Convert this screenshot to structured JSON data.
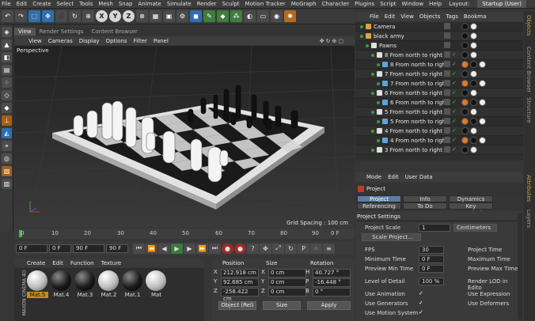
{
  "menubar": {
    "items": [
      "File",
      "Edit",
      "Create",
      "Select",
      "Tools",
      "Mesh",
      "Snap",
      "Animate",
      "Simulate",
      "Render",
      "Sculpt",
      "Motion Tracker",
      "MoGraph",
      "Character",
      "Plugins",
      "Script",
      "Window",
      "Help"
    ],
    "layout_label": "Layout:",
    "layout_value": "Startup (User)"
  },
  "toolbar": {
    "axis_buttons": [
      "X",
      "Y",
      "Z"
    ]
  },
  "viewport": {
    "tabs": [
      "View",
      "Render Settings",
      "Content Browser"
    ],
    "menu": [
      "View",
      "Cameras",
      "Display",
      "Options",
      "Filter",
      "Panel"
    ],
    "camera_label": "Perspective",
    "grid_spacing": "Grid Spacing : 100 cm"
  },
  "timeline": {
    "ticks": [
      "0",
      "10",
      "20",
      "30",
      "40",
      "50",
      "60",
      "70",
      "80",
      "90"
    ],
    "end_label": "0 F"
  },
  "transport": {
    "start_frame": "0 F",
    "current_frame": "0 F",
    "end_frame": "90 F",
    "max_frame": "90 F"
  },
  "materials": {
    "menu": [
      "Create",
      "Edit",
      "Function",
      "Texture"
    ],
    "items": [
      {
        "label": "Mat.5",
        "color": "white",
        "selected": true
      },
      {
        "label": "Mat.4",
        "color": "black",
        "selected": false
      },
      {
        "label": "Mat.3",
        "color": "black",
        "selected": false
      },
      {
        "label": "Mat.2",
        "color": "white",
        "selected": false
      },
      {
        "label": "Mat.1",
        "color": "black",
        "selected": false
      },
      {
        "label": "Mat",
        "color": "white",
        "selected": false
      }
    ],
    "brand": "MAXON CINEMA 4D"
  },
  "coordinates": {
    "headers": [
      "Position",
      "Size",
      "Rotation"
    ],
    "rows": [
      {
        "axis": "X",
        "pos": "212.918 cm",
        "size_axis": "X",
        "size": "0 cm",
        "rot_axis": "H",
        "rot": "40.727 °"
      },
      {
        "axis": "Y",
        "pos": "92.685 cm",
        "size_axis": "Y",
        "size": "0 cm",
        "rot_axis": "P",
        "rot": "-16.448 °"
      },
      {
        "axis": "Z",
        "pos": "-258.422 cm",
        "size_axis": "Z",
        "size": "0 cm",
        "rot_axis": "B",
        "rot": "0 °"
      }
    ],
    "mode_select": "Object (Rel)",
    "size_select": "Size",
    "apply_label": "Apply"
  },
  "objects": {
    "menu": [
      "File",
      "Edit",
      "View",
      "Objects",
      "Tags",
      "Bookma"
    ],
    "rows": [
      {
        "name": "Camera",
        "indent": 0,
        "checked": false
      },
      {
        "name": "black army",
        "indent": 0,
        "checked": false
      },
      {
        "name": "Pawns",
        "indent": 1,
        "checked": false
      },
      {
        "name": "8 From north to right",
        "indent": 2,
        "checked": true
      },
      {
        "name": "8 From north to right",
        "indent": 3,
        "checked": true
      },
      {
        "name": "7 From north to right",
        "indent": 2,
        "checked": true
      },
      {
        "name": "7 From north to right",
        "indent": 3,
        "checked": true
      },
      {
        "name": "6 From north to right",
        "indent": 2,
        "checked": true
      },
      {
        "name": "6 From north to right",
        "indent": 3,
        "checked": true
      },
      {
        "name": "5 From north to right",
        "indent": 2,
        "checked": true
      },
      {
        "name": "5 From north to right",
        "indent": 3,
        "checked": true
      },
      {
        "name": "4 From north to right",
        "indent": 2,
        "checked": true
      },
      {
        "name": "4 From north to right",
        "indent": 3,
        "checked": true
      },
      {
        "name": "3 From north to right",
        "indent": 2,
        "checked": true
      }
    ]
  },
  "side_tabs": [
    "Objects",
    "Content Browser",
    "Structure",
    "Attributes",
    "Layers"
  ],
  "attributes": {
    "menu": [
      "Mode",
      "Edit",
      "User Data"
    ],
    "title": "Project",
    "tabs_row1": [
      "Project Settings",
      "Info",
      "Dynamics"
    ],
    "tabs_row2": [
      "Referencing",
      "To Do",
      "Key Interpolation"
    ],
    "section": "Project Settings",
    "project_scale_label": "Project Scale",
    "project_scale_value": "1",
    "project_scale_unit": "Centimeters",
    "scale_project_button": "Scale Project...",
    "fps_label": "FPS",
    "fps_value": "30",
    "project_time_label": "Project Time",
    "min_time_label": "Minimum Time",
    "min_time_value": "0 F",
    "max_time_label": "Maximum Time",
    "preview_min_label": "Preview Min Time",
    "preview_min_value": "0 F",
    "preview_max_label": "Preview Max Time",
    "lod_label": "Level of Detail",
    "lod_value": "100 %",
    "render_lod_label": "Render LOD in Edito",
    "use_animation": "Use Animation",
    "use_expression": "Use Expression",
    "use_generators": "Use Generators",
    "use_deformers": "Use Deformers",
    "use_motion": "Use Motion System"
  }
}
